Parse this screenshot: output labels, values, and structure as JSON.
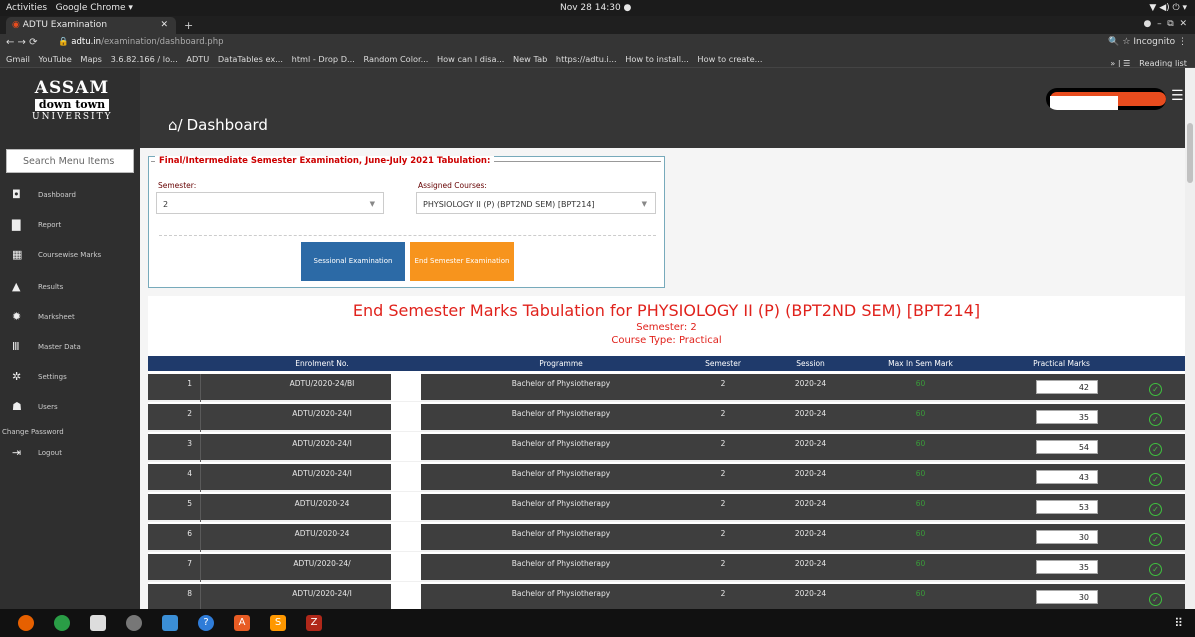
{
  "os": {
    "activities": "Activities",
    "app_menu": "Google Chrome ▾",
    "clock": "Nov 28 14:30 ●",
    "tray": "▼ ◀) ⏻ ▾"
  },
  "browser": {
    "tab_title": "ADTU Examination",
    "url_host": "adtu.in",
    "url_path": "/examination/dashboard.php",
    "incognito": "Incognito",
    "bookmarks": [
      "Gmail",
      "YouTube",
      "Maps",
      "3.6.82.166 / lo...",
      "ADTU",
      "DataTables ex...",
      "html - Drop D...",
      "Random Color...",
      "How can I disa...",
      "New Tab",
      "https://adtu.i...",
      "How to install...",
      "How to create..."
    ],
    "reading_list": "Reading list"
  },
  "sidebar": {
    "logo": {
      "line1": "ASSAM",
      "line2": "down town",
      "line3": "UNIVERSITY"
    },
    "search_placeholder": "Search Menu Items",
    "items": [
      {
        "label": "Dashboard",
        "icon": "dashboard-icon"
      },
      {
        "label": "Report",
        "icon": "file-icon"
      },
      {
        "label": "Coursewise Marks",
        "icon": "file-text-icon"
      },
      {
        "label": "Results",
        "icon": "graduation-icon"
      },
      {
        "label": "Marksheet",
        "icon": "gear-icon"
      },
      {
        "label": "Master Data",
        "icon": "bank-icon"
      },
      {
        "label": "Settings",
        "icon": "cog-icon"
      },
      {
        "label": "Users",
        "icon": "users-icon"
      }
    ],
    "change_password": "Change Password",
    "logout": "Logout"
  },
  "header": {
    "title": "Dashboard"
  },
  "panel": {
    "legend": "Final/Intermediate Semester Examination, June-July 2021 Tabulation:",
    "semester_label": "Semester:",
    "semester_value": "2",
    "courses_label": "Assigned Courses:",
    "courses_value": "PHYSIOLOGY II (P) (BPT2ND SEM) [BPT214]",
    "btn_sessional": "Sessional Examination",
    "btn_endsem": "End Semester Examination"
  },
  "table": {
    "title": "End Semester Marks Tabulation for PHYSIOLOGY II (P) (BPT2ND SEM) [BPT214]",
    "semester": "Semester: 2",
    "course_type": "Course Type: Practical",
    "headers": [
      "",
      "Enrolment No.",
      "Programme",
      "Semester",
      "Session",
      "Max In Sem Mark",
      "Practical Marks",
      ""
    ],
    "rows": [
      {
        "sn": "1",
        "enrol": "ADTU/2020-24/BI",
        "programme": "Bachelor of Physiotherapy",
        "semester": "2",
        "session": "2020-24",
        "max": "60",
        "marks": "42"
      },
      {
        "sn": "2",
        "enrol": "ADTU/2020-24/I",
        "programme": "Bachelor of Physiotherapy",
        "semester": "2",
        "session": "2020-24",
        "max": "60",
        "marks": "35"
      },
      {
        "sn": "3",
        "enrol": "ADTU/2020-24/I",
        "programme": "Bachelor of Physiotherapy",
        "semester": "2",
        "session": "2020-24",
        "max": "60",
        "marks": "54"
      },
      {
        "sn": "4",
        "enrol": "ADTU/2020-24/I",
        "programme": "Bachelor of Physiotherapy",
        "semester": "2",
        "session": "2020-24",
        "max": "60",
        "marks": "43"
      },
      {
        "sn": "5",
        "enrol": "ADTU/2020-24",
        "programme": "Bachelor of Physiotherapy",
        "semester": "2",
        "session": "2020-24",
        "max": "60",
        "marks": "53"
      },
      {
        "sn": "6",
        "enrol": "ADTU/2020-24",
        "programme": "Bachelor of Physiotherapy",
        "semester": "2",
        "session": "2020-24",
        "max": "60",
        "marks": "30"
      },
      {
        "sn": "7",
        "enrol": "ADTU/2020-24/",
        "programme": "Bachelor of Physiotherapy",
        "semester": "2",
        "session": "2020-24",
        "max": "60",
        "marks": "35"
      },
      {
        "sn": "8",
        "enrol": "ADTU/2020-24/I",
        "programme": "Bachelor of Physiotherapy",
        "semester": "2",
        "session": "2020-24",
        "max": "60",
        "marks": "30"
      }
    ]
  }
}
